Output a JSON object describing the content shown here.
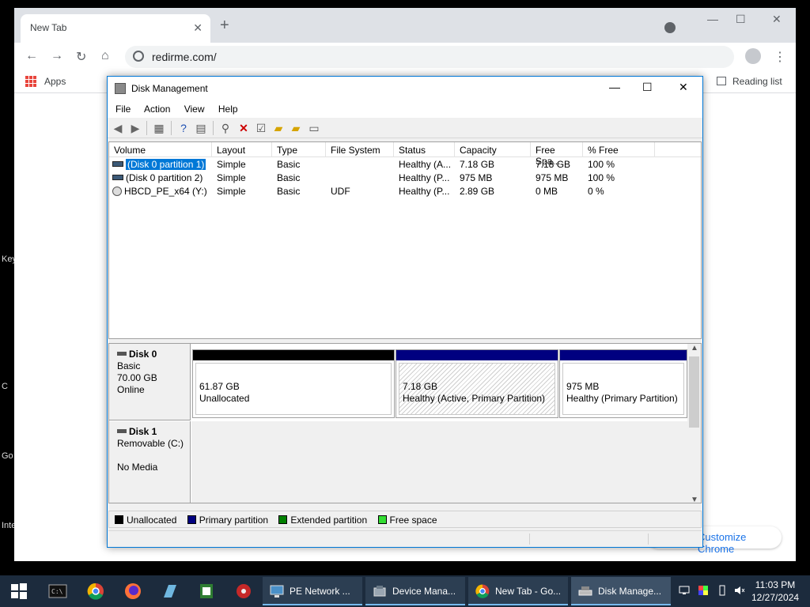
{
  "desktop": {
    "labels": [
      "Key",
      "C",
      "Go",
      "Inte"
    ]
  },
  "chrome": {
    "tab_title": "New Tab",
    "url": "redirme.com/",
    "bookmarks": {
      "apps_label": "Apps",
      "reading_list_label": "Reading list"
    },
    "customize_label": "Customize Chrome"
  },
  "diskmgmt": {
    "title": "Disk Management",
    "menu": [
      "File",
      "Action",
      "View",
      "Help"
    ],
    "columns": [
      "Volume",
      "Layout",
      "Type",
      "File System",
      "Status",
      "Capacity",
      "Free Spa...",
      "% Free"
    ],
    "volumes": [
      {
        "volume": "(Disk 0 partition 1)",
        "layout": "Simple",
        "type": "Basic",
        "fs": "",
        "status": "Healthy (A...",
        "capacity": "7.18 GB",
        "free": "7.18 GB",
        "pct": "100 %"
      },
      {
        "volume": "(Disk 0 partition 2)",
        "layout": "Simple",
        "type": "Basic",
        "fs": "",
        "status": "Healthy (P...",
        "capacity": "975 MB",
        "free": "975 MB",
        "pct": "100 %"
      },
      {
        "volume": "HBCD_PE_x64 (Y:)",
        "layout": "Simple",
        "type": "Basic",
        "fs": "UDF",
        "status": "Healthy (P...",
        "capacity": "2.89 GB",
        "free": "0 MB",
        "pct": "0 %"
      }
    ],
    "disks": [
      {
        "name": "Disk 0",
        "kind": "Basic",
        "size": "70.00 GB",
        "state": "Online",
        "partitions": [
          {
            "size": "61.87 GB",
            "label": "Unallocated"
          },
          {
            "size": "7.18 GB",
            "label": "Healthy (Active, Primary Partition)"
          },
          {
            "size": "975 MB",
            "label": "Healthy (Primary Partition)"
          }
        ]
      },
      {
        "name": "Disk 1",
        "kind": "Removable (C:)",
        "state": "No Media"
      }
    ],
    "legend": [
      "Unallocated",
      "Primary partition",
      "Extended partition",
      "Free space"
    ]
  },
  "colors": {
    "unallocated": "#000000",
    "primary": "#000080",
    "extended": "#008000",
    "free": "#33dd33",
    "selection": "#0078d7"
  },
  "taskbar": {
    "buttons": [
      "PE Network ...",
      "Device Mana...",
      "New Tab - Go...",
      "Disk Manage..."
    ],
    "time": "11:03 PM",
    "date": "12/27/2024"
  }
}
